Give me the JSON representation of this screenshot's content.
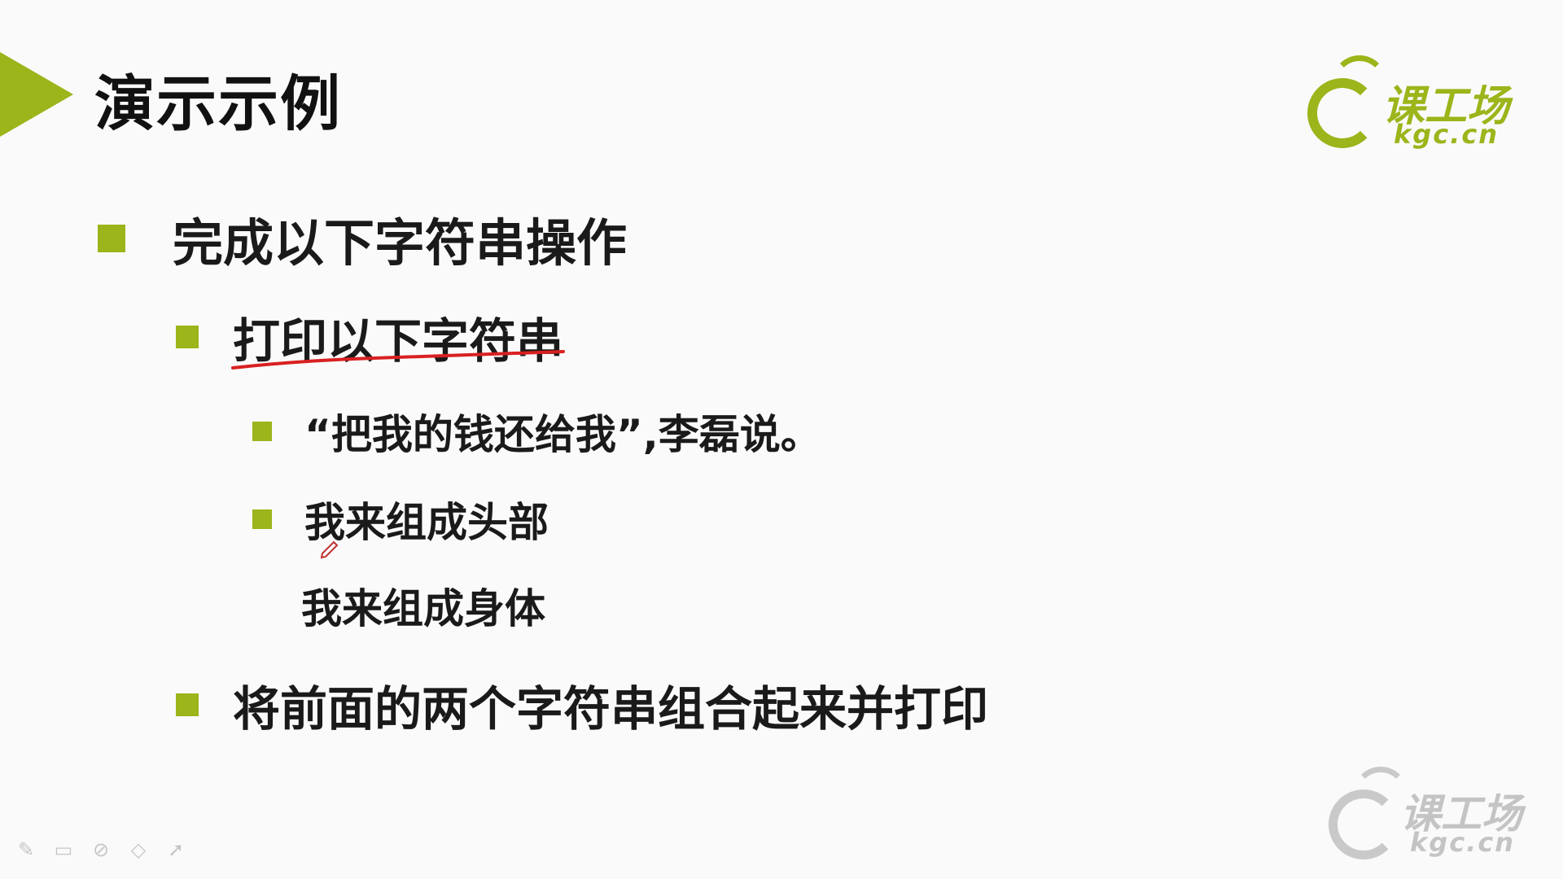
{
  "slide": {
    "title": "演示示例",
    "bullets": {
      "b1": "完成以下字符串操作",
      "b2": "打印以下字符串",
      "b3": "“把我的钱还给我”,李磊说。",
      "b4": "我来组成头部",
      "b4_cont": "我来组成身体",
      "b5": "将前面的两个字符串组合起来并打印"
    }
  },
  "logo": {
    "cn": "课工场",
    "en": "kgc.cn"
  },
  "colors": {
    "accent": "#9bb51a",
    "annotation": "#d92020"
  },
  "toolbar": {
    "icons": [
      "pen-icon",
      "screen-icon",
      "eraser-icon",
      "highlighter-icon",
      "pointer-icon"
    ]
  }
}
